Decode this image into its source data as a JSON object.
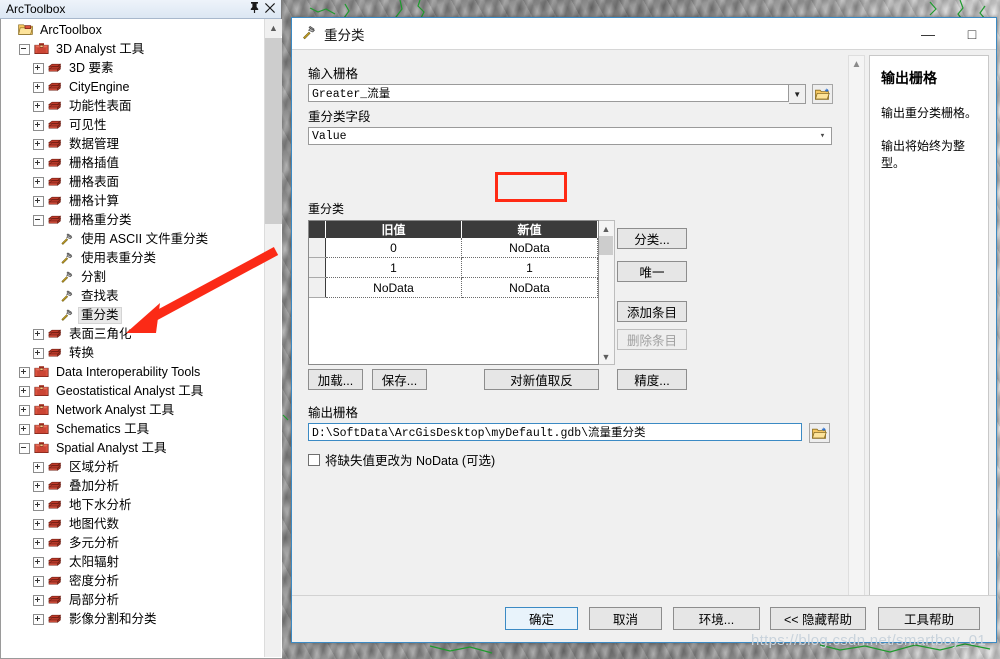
{
  "colors": {
    "accent": "#3b8ac4",
    "annotation_red": "#ff2a14",
    "grid_header_bg": "#3b3b3b",
    "dialog_bg": "#f0f0f0",
    "panel_title_bg": "#dce7f3"
  },
  "toolbox_panel": {
    "title": "ArcToolbox",
    "pin_icon": "pin-icon",
    "close_icon": "close-icon",
    "tree": [
      {
        "label": "ArcToolbox",
        "indent": 0,
        "state": "root",
        "icon": "toolbox-folder-icon"
      },
      {
        "label": "3D Analyst 工具",
        "indent": 1,
        "state": "expanded",
        "icon": "toolbox-icon"
      },
      {
        "label": "3D 要素",
        "indent": 2,
        "state": "collapsed",
        "icon": "toolset-icon"
      },
      {
        "label": "CityEngine",
        "indent": 2,
        "state": "collapsed",
        "icon": "toolset-icon"
      },
      {
        "label": "功能性表面",
        "indent": 2,
        "state": "collapsed",
        "icon": "toolset-icon"
      },
      {
        "label": "可见性",
        "indent": 2,
        "state": "collapsed",
        "icon": "toolset-icon"
      },
      {
        "label": "数据管理",
        "indent": 2,
        "state": "collapsed",
        "icon": "toolset-icon"
      },
      {
        "label": "栅格插值",
        "indent": 2,
        "state": "collapsed",
        "icon": "toolset-icon"
      },
      {
        "label": "栅格表面",
        "indent": 2,
        "state": "collapsed",
        "icon": "toolset-icon"
      },
      {
        "label": "栅格计算",
        "indent": 2,
        "state": "collapsed",
        "icon": "toolset-icon"
      },
      {
        "label": "栅格重分类",
        "indent": 2,
        "state": "expanded",
        "icon": "toolset-icon"
      },
      {
        "label": "使用 ASCII 文件重分类",
        "indent": 3,
        "state": "leaf",
        "icon": "tool-hammer-icon"
      },
      {
        "label": "使用表重分类",
        "indent": 3,
        "state": "leaf",
        "icon": "tool-hammer-icon"
      },
      {
        "label": "分割",
        "indent": 3,
        "state": "leaf",
        "icon": "tool-hammer-icon"
      },
      {
        "label": "查找表",
        "indent": 3,
        "state": "leaf",
        "icon": "tool-hammer-icon"
      },
      {
        "label": "重分类",
        "indent": 3,
        "state": "leaf",
        "icon": "tool-hammer-icon",
        "selected": true
      },
      {
        "label": "表面三角化",
        "indent": 2,
        "state": "collapsed",
        "icon": "toolset-icon"
      },
      {
        "label": "转换",
        "indent": 2,
        "state": "collapsed",
        "icon": "toolset-icon"
      },
      {
        "label": "Data Interoperability Tools",
        "indent": 1,
        "state": "collapsed",
        "icon": "toolbox-icon"
      },
      {
        "label": "Geostatistical Analyst 工具",
        "indent": 1,
        "state": "collapsed",
        "icon": "toolbox-icon"
      },
      {
        "label": "Network Analyst 工具",
        "indent": 1,
        "state": "collapsed",
        "icon": "toolbox-icon"
      },
      {
        "label": "Schematics 工具",
        "indent": 1,
        "state": "collapsed",
        "icon": "toolbox-icon"
      },
      {
        "label": "Spatial Analyst 工具",
        "indent": 1,
        "state": "expanded",
        "icon": "toolbox-icon"
      },
      {
        "label": "区域分析",
        "indent": 2,
        "state": "collapsed",
        "icon": "toolset-icon"
      },
      {
        "label": "叠加分析",
        "indent": 2,
        "state": "collapsed",
        "icon": "toolset-icon"
      },
      {
        "label": "地下水分析",
        "indent": 2,
        "state": "collapsed",
        "icon": "toolset-icon"
      },
      {
        "label": "地图代数",
        "indent": 2,
        "state": "collapsed",
        "icon": "toolset-icon"
      },
      {
        "label": "多元分析",
        "indent": 2,
        "state": "collapsed",
        "icon": "toolset-icon"
      },
      {
        "label": "太阳辐射",
        "indent": 2,
        "state": "collapsed",
        "icon": "toolset-icon"
      },
      {
        "label": "密度分析",
        "indent": 2,
        "state": "collapsed",
        "icon": "toolset-icon"
      },
      {
        "label": "局部分析",
        "indent": 2,
        "state": "collapsed",
        "icon": "toolset-icon"
      },
      {
        "label": "影像分割和分类",
        "indent": 2,
        "state": "collapsed",
        "icon": "toolset-icon"
      }
    ]
  },
  "dialog": {
    "title": "重分类",
    "title_icon": "tool-hammer-icon",
    "minimize_label": "—",
    "input_raster": {
      "label": "输入栅格",
      "value": "Greater_流量",
      "dropdown_icon": "chevron-down-icon",
      "browse_icon": "open-folder-icon"
    },
    "reclass_field": {
      "label": "重分类字段",
      "value": "Value",
      "dropdown_icon": "chevron-down-icon"
    },
    "reclass_table": {
      "label": "重分类",
      "columns": [
        "旧值",
        "新值"
      ],
      "rows": [
        {
          "old": "0",
          "new": "NoData"
        },
        {
          "old": "1",
          "new": "1"
        },
        {
          "old": "NoData",
          "new": "NoData"
        }
      ],
      "side_buttons": [
        {
          "label": "分类...",
          "name": "classify-button",
          "disabled": false
        },
        {
          "label": "唯一",
          "name": "unique-button",
          "disabled": false
        },
        {
          "label": "添加条目",
          "name": "add-entry-button",
          "disabled": false
        },
        {
          "label": "删除条目",
          "name": "delete-entry-button",
          "disabled": true
        },
        {
          "label": "精度...",
          "name": "precision-button",
          "disabled": false
        }
      ],
      "bottom_buttons": [
        {
          "label": "加载...",
          "name": "load-button"
        },
        {
          "label": "保存...",
          "name": "save-button"
        },
        {
          "label": "对新值取反",
          "name": "reverse-new-values-button"
        }
      ]
    },
    "output_raster": {
      "label": "输出栅格",
      "value": "D:\\SoftData\\ArcGisDesktop\\myDefault.gdb\\流量重分类",
      "browse_icon": "open-folder-icon"
    },
    "missing_values_checkbox": {
      "label": "将缺失值更改为 NoData (可选)",
      "checked": false
    },
    "footer_buttons": [
      {
        "label": "确定",
        "name": "ok-button",
        "default": true
      },
      {
        "label": "取消",
        "name": "cancel-button",
        "default": false
      },
      {
        "label": "环境...",
        "name": "environments-button",
        "default": false
      },
      {
        "label": "<< 隐藏帮助",
        "name": "hide-help-button",
        "default": false
      },
      {
        "label": "工具帮助",
        "name": "tool-help-button",
        "default": false
      }
    ],
    "help": {
      "title": "输出栅格",
      "paragraphs": [
        "输出重分类栅格。",
        "输出将始终为整型。"
      ]
    }
  },
  "watermark": "https://blog.csdn.net/smartboy_01"
}
